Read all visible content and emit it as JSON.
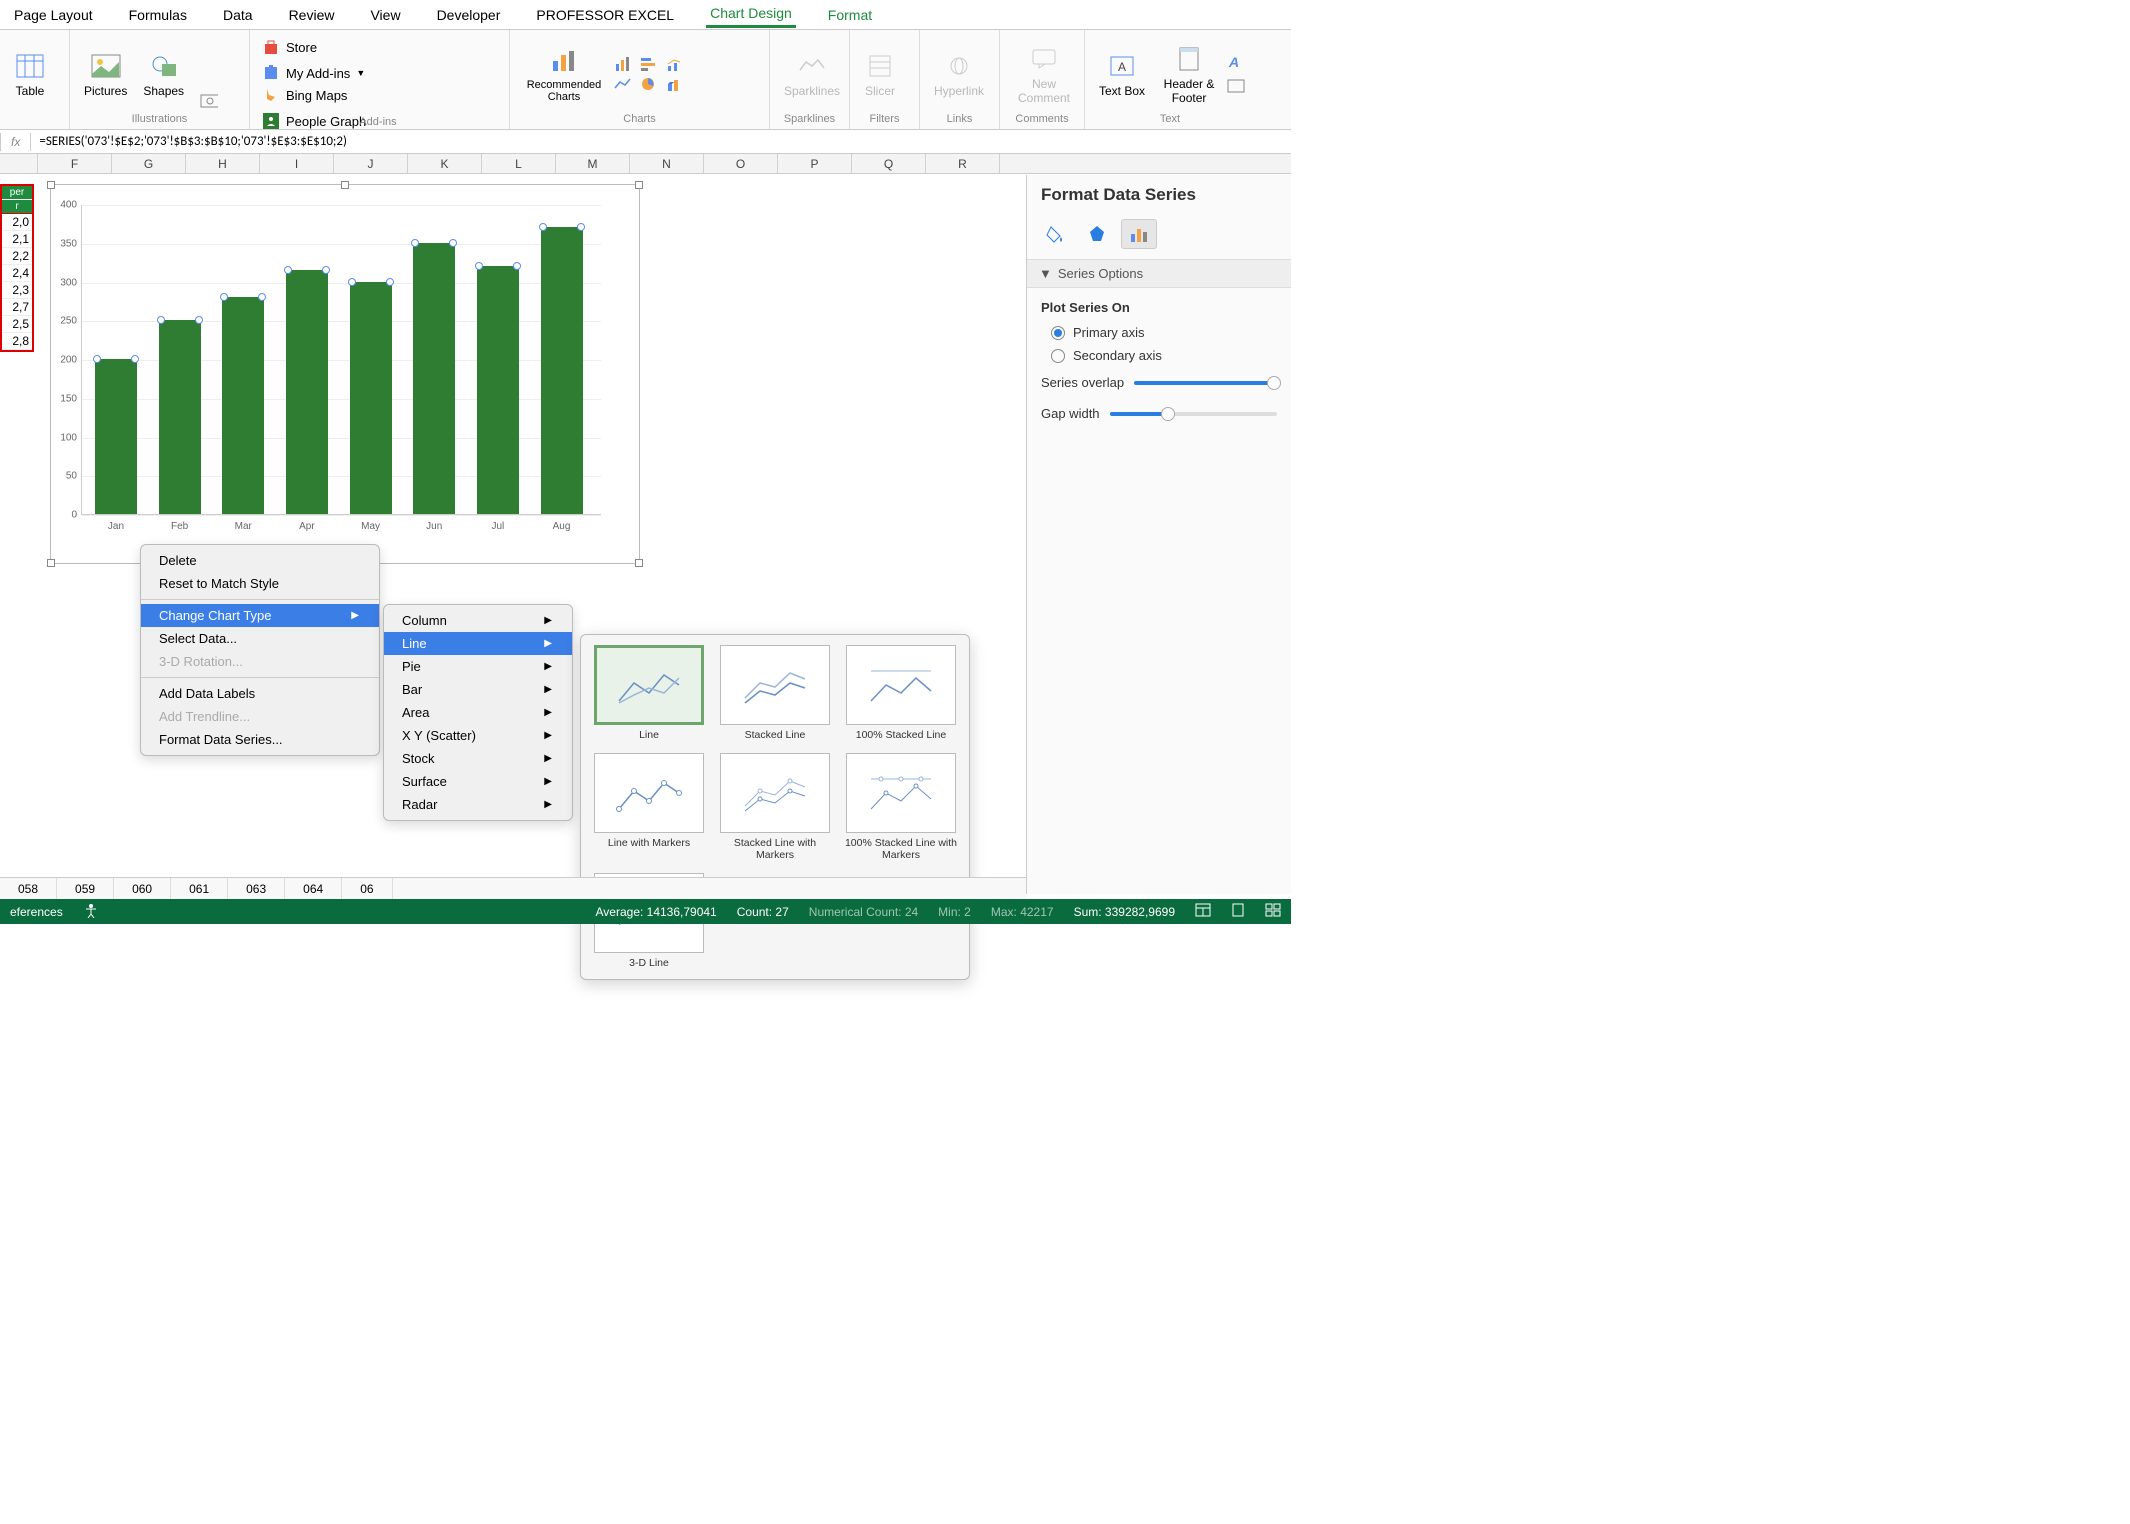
{
  "ribbon": {
    "tabs": [
      "Page Layout",
      "Formulas",
      "Data",
      "Review",
      "View",
      "Developer",
      "PROFESSOR EXCEL",
      "Chart Design",
      "Format"
    ],
    "active": "Chart Design"
  },
  "toolbar": {
    "table": "Table",
    "pictures": "Pictures",
    "shapes": "Shapes",
    "illustrations_label": "Illustrations",
    "store": "Store",
    "my_addins": "My Add-ins",
    "bing_maps": "Bing Maps",
    "people_graph": "People Graph",
    "addins_label": "Add-ins",
    "recommended_charts": "Recommended Charts",
    "charts_label": "Charts",
    "sparklines": "Sparklines",
    "sparklines_label": "Sparklines",
    "slicer": "Slicer",
    "filters_label": "Filters",
    "hyperlink": "Hyperlink",
    "links_label": "Links",
    "new_comment": "New Comment",
    "comments_label": "Comments",
    "text_box": "Text Box",
    "header_footer": "Header & Footer",
    "text_label": "Text"
  },
  "formula_bar": {
    "fx": "fx",
    "value": "=SERIES('073'!$E$2;'073'!$B$3:$B$10;'073'!$E$3:$E$10;2)"
  },
  "columns": [
    "F",
    "G",
    "H",
    "I",
    "J",
    "K",
    "L",
    "M",
    "N",
    "O",
    "P",
    "Q",
    "R"
  ],
  "data_cells": {
    "header1": "per",
    "header2": "r",
    "values": [
      "2,0",
      "2,1",
      "2,2",
      "2,4",
      "2,3",
      "2,7",
      "2,5",
      "2,8"
    ]
  },
  "chart_data": {
    "type": "bar",
    "categories": [
      "Jan",
      "Feb",
      "Mar",
      "Apr",
      "May",
      "Jun",
      "Jul",
      "Aug"
    ],
    "values": [
      200,
      250,
      280,
      315,
      300,
      350,
      320,
      370
    ],
    "ylim": [
      0,
      400
    ],
    "yticks": [
      0,
      50,
      100,
      150,
      200,
      250,
      300,
      350,
      400
    ],
    "xlabel": "",
    "ylabel": "",
    "title": ""
  },
  "context_menu": {
    "items": [
      {
        "label": "Delete",
        "enabled": true
      },
      {
        "label": "Reset to Match Style",
        "enabled": true
      },
      {
        "sep": true
      },
      {
        "label": "Change Chart Type",
        "enabled": true,
        "submenu": true,
        "highlight": true
      },
      {
        "label": "Select Data...",
        "enabled": true
      },
      {
        "label": "3-D Rotation...",
        "enabled": false
      },
      {
        "sep": true
      },
      {
        "label": "Add Data Labels",
        "enabled": true
      },
      {
        "label": "Add Trendline...",
        "enabled": false
      },
      {
        "label": "Format Data Series...",
        "enabled": true
      }
    ],
    "chart_types": [
      {
        "label": "Column",
        "submenu": true
      },
      {
        "label": "Line",
        "submenu": true,
        "highlight": true
      },
      {
        "label": "Pie",
        "submenu": true
      },
      {
        "label": "Bar",
        "submenu": true
      },
      {
        "label": "Area",
        "submenu": true
      },
      {
        "label": "X Y (Scatter)",
        "submenu": true
      },
      {
        "label": "Stock",
        "submenu": true
      },
      {
        "label": "Surface",
        "submenu": true
      },
      {
        "label": "Radar",
        "submenu": true
      }
    ],
    "line_gallery": [
      {
        "label": "Line",
        "selected": true
      },
      {
        "label": "Stacked Line"
      },
      {
        "label": "100% Stacked Line"
      },
      {
        "label": "Line with Markers"
      },
      {
        "label": "Stacked Line with Markers"
      },
      {
        "label": "100% Stacked Line with Markers"
      },
      {
        "label": "3-D Line"
      }
    ]
  },
  "format_pane": {
    "title": "Format Data Series",
    "section": "Series Options",
    "plot_label": "Plot Series On",
    "primary": "Primary axis",
    "secondary": "Secondary axis",
    "overlap": "Series overlap",
    "gap": "Gap width"
  },
  "sheet_tabs": [
    "058",
    "059",
    "060",
    "061",
    "063",
    "064",
    "06"
  ],
  "status_bar": {
    "references": "eferences",
    "average": "Average: 14136,79041",
    "count": "Count: 27",
    "numcount": "Numerical Count: 24",
    "min": "Min: 2",
    "max": "Max: 42217",
    "sum": "Sum: 339282,9699"
  }
}
